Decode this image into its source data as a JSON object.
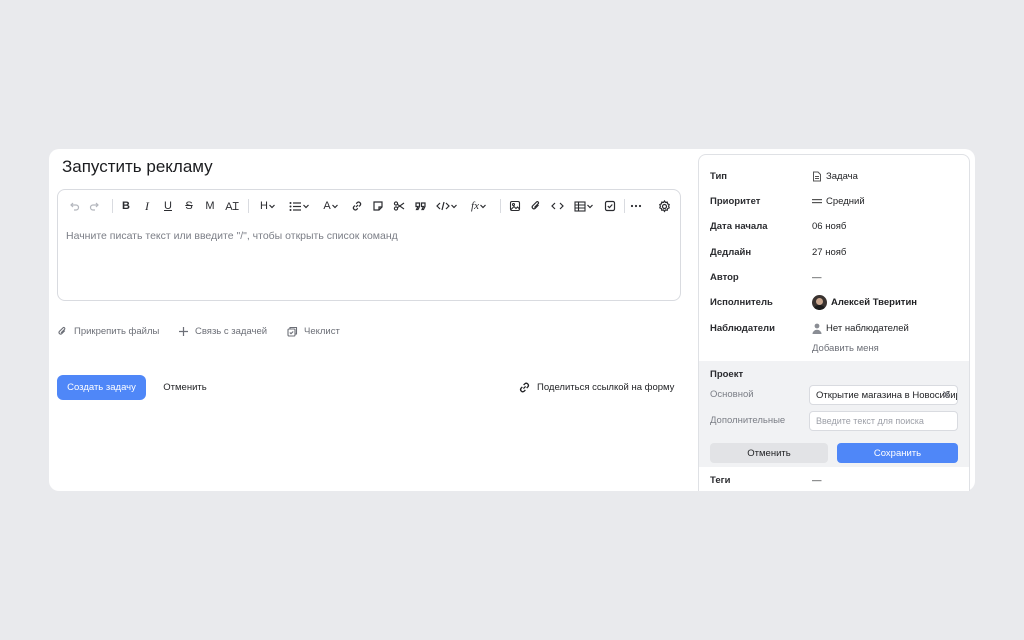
{
  "task": {
    "title": "Запустить рекламу",
    "editor_placeholder": "Начните писать текст или введите \"/\", чтобы открыть список команд"
  },
  "toolbar": {
    "icons": [
      "undo-icon",
      "redo-icon",
      "bold-icon",
      "italic-icon",
      "underline-icon",
      "strikethrough-icon",
      "monospace-icon",
      "clear-format-icon",
      "heading-icon",
      "list-icon",
      "text-color-icon",
      "link-icon",
      "sticker-icon",
      "cut-icon",
      "quote-icon",
      "code-embed-icon",
      "formula-icon",
      "image-icon",
      "attachment-icon",
      "code-block-icon",
      "table-icon",
      "checkbox-icon",
      "more-icon",
      "settings-icon"
    ]
  },
  "actions": {
    "attach_files": "Прикрепить файлы",
    "link_task": "Связь с задачей",
    "checklist": "Чеклист"
  },
  "footer": {
    "create": "Создать задачу",
    "cancel": "Отменить",
    "share": "Поделиться ссылкой на форму"
  },
  "sidebar": {
    "type_label": "Тип",
    "type_value": "Задача",
    "priority_label": "Приоритет",
    "priority_value": "Средний",
    "start_label": "Дата начала",
    "start_value": "06 нояб",
    "deadline_label": "Дедлайн",
    "deadline_value": "27 нояб",
    "author_label": "Автор",
    "author_value": "—",
    "assignee_label": "Исполнитель",
    "assignee_value": "Алексей Тверитин",
    "watchers_label": "Наблюдатели",
    "watchers_value": "Нет наблюдателей",
    "add_me": "Добавить меня",
    "tags_label": "Теги",
    "tags_value": "—"
  },
  "project": {
    "title": "Проект",
    "main_label": "Основной",
    "main_value": "Открытие магазина в Новосибирске",
    "extra_label": "Дополнительные",
    "extra_placeholder": "Введите текст для поиска",
    "cancel": "Отменить",
    "save": "Сохранить"
  },
  "colors": {
    "accent": "#4f87f8",
    "background": "#e9eaed"
  }
}
